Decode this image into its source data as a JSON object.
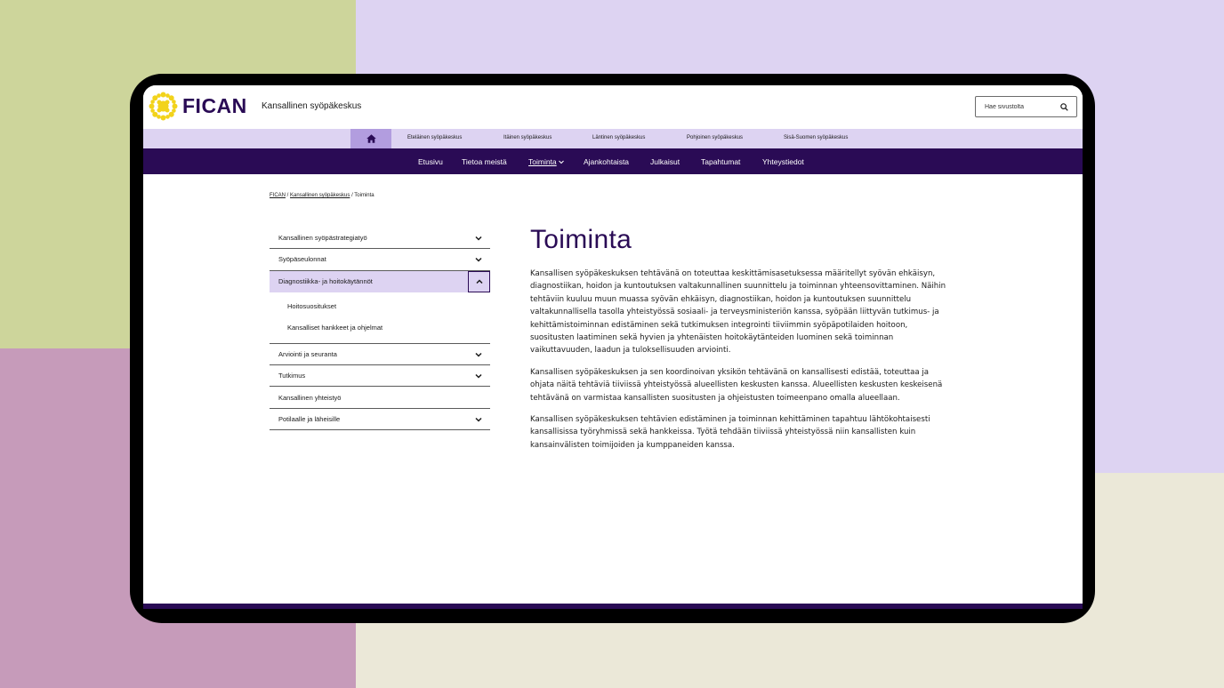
{
  "header": {
    "logo_text": "FICAN",
    "site_name": "Kansallinen syöpäkeskus",
    "search_placeholder": "Hae sivustolta"
  },
  "region_nav": {
    "home_icon": "home-icon",
    "items": [
      "Eteläinen syöpäkeskus",
      "Itäinen syöpäkeskus",
      "Läntinen syöpäkeskus",
      "Pohjoinen syöpäkeskus",
      "Sisä-Suomen syöpäkeskus"
    ]
  },
  "main_nav": {
    "items": [
      "Etusivu",
      "Tietoa meistä",
      "Toiminta",
      "Ajankohtaista",
      "Julkaisut",
      "Tapahtumat",
      "Yhteystiedot"
    ],
    "active": "Toiminta"
  },
  "breadcrumb": {
    "items": [
      "FICAN",
      "Kansallinen syöpäkeskus",
      "Toiminta"
    ],
    "separator": "/"
  },
  "side_menu": {
    "items": [
      "Kansallinen syöpästrategiatyö",
      "Syöpäseulonnat",
      "Diagnostiikka- ja hoitokäytännöt",
      "Arviointi ja seuranta",
      "Tutkimus",
      "Kansallinen yhteistyö",
      "Potilaalle ja läheisille"
    ],
    "subitems": [
      "Hoitosuositukset",
      "Kansalliset hankkeet ja ohjelmat"
    ]
  },
  "content": {
    "title": "Toiminta",
    "paragraphs": [
      "Kansallisen syöpäkeskuksen tehtävänä on toteuttaa keskittämisasetuksessa määritellyt syövän ehkäisyn, diagnostiikan, hoidon ja kuntoutuksen valtakunnallinen suunnittelu ja toiminnan yhteensovittaminen. Näihin tehtäviin kuuluu muun muassa syövän ehkäisyn, diagnostiikan, hoidon ja kuntoutuksen suunnittelu valtakunnallisella tasolla yhteistyössä sosiaali- ja terveysministeriön kanssa, syöpään liittyvän tutkimus- ja kehittämistoiminnan edistäminen sekä tutkimuksen integrointi tiiviimmin syöpäpotilaiden hoitoon, suositusten laatiminen sekä hyvien ja yhtenäisten hoitokäytänteiden luominen sekä toiminnan vaikuttavuuden, laadun ja tuloksellisuuden arviointi.",
      "Kansallisen syöpäkeskuksen ja sen koordinoivan yksikön tehtävänä on kansallisesti edistää, toteuttaa ja ohjata näitä tehtäviä tiiviissä yhteistyössä alueellisten keskusten kanssa. Alueellisten keskusten keskeisenä tehtävänä on varmistaa kansallisten suositusten ja ohjeistusten toimeenpano omalla alueellaan.",
      "Kansallisen syöpäkeskuksen tehtävien edistäminen ja toiminnan kehittäminen tapahtuu lähtökohtaisesti kansallisissa työryhmissä sekä hankkeissa. Työtä tehdään tiiviissä yhteistyössä niin kansallisten kuin kansainvälisten toimijoiden ja kumppaneiden kanssa."
    ]
  },
  "colors": {
    "brand": "#2a0b55",
    "lavender": "#ddd3f2",
    "lavender_dark": "#b29ddf",
    "logo_yellow": "#f2d31b",
    "bg_green": "#cdd59b",
    "bg_pink": "#c69bba",
    "bg_cream": "#ebe8d8"
  }
}
